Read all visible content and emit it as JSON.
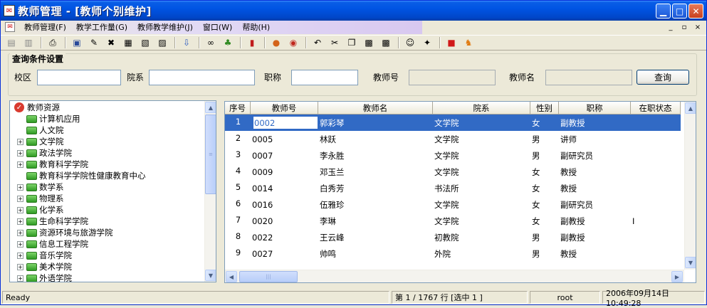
{
  "window": {
    "title": "教师管理 - [教师个别维护]",
    "title_icon": "app-icon",
    "accent": "#0054E3"
  },
  "menu": {
    "items": [
      "教师管理(F)",
      "教学工作量(G)",
      "教师教学维护(J)",
      "窗口(W)",
      "帮助(H)"
    ],
    "mdi": [
      "_",
      "▫",
      "×"
    ]
  },
  "toolbar": {
    "icons": [
      "new-icon",
      "delete-icon",
      "print-icon",
      "save-icon",
      "edit-icon",
      "cancel-icon",
      "disk-icon",
      "calc-icon",
      "trash-icon",
      "import-icon",
      "link-icon",
      "tree-icon",
      "chart-icon",
      "globe-icon",
      "color-icon",
      "undo-icon",
      "cut-icon",
      "copy-icon",
      "paste-icon",
      "paste2-icon",
      "user-icon",
      "tag-icon",
      "stop-icon",
      "run-icon"
    ]
  },
  "query": {
    "legend": "查询条件设置",
    "campus_label": "校区",
    "dept_label": "院系",
    "title_label": "职称",
    "teacher_no_label": "教师号",
    "teacher_name_label": "教师名",
    "search_button": "查询"
  },
  "tree": {
    "root": "教师资源",
    "items": [
      {
        "label": "计算机应用",
        "expandable": false
      },
      {
        "label": "人文院",
        "expandable": false
      },
      {
        "label": "文学院",
        "expandable": true
      },
      {
        "label": "政法学院",
        "expandable": true
      },
      {
        "label": "教育科学学院",
        "expandable": true
      },
      {
        "label": "教育科学学院性健康教育中心",
        "expandable": false
      },
      {
        "label": "数学系",
        "expandable": true
      },
      {
        "label": "物理系",
        "expandable": true
      },
      {
        "label": "化学系",
        "expandable": true
      },
      {
        "label": "生命科学学院",
        "expandable": true
      },
      {
        "label": "资源环境与旅游学院",
        "expandable": true
      },
      {
        "label": "信息工程学院",
        "expandable": true
      },
      {
        "label": "音乐学院",
        "expandable": true
      },
      {
        "label": "美术学院",
        "expandable": true
      },
      {
        "label": "外语学院",
        "expandable": true
      }
    ]
  },
  "grid": {
    "columns": [
      "序号",
      "教师号",
      "教师名",
      "院系",
      "性别",
      "职称",
      "在职状态"
    ],
    "rows": [
      [
        "1",
        "0002",
        "郭彩琴",
        "文学院",
        "女",
        "副教授",
        ""
      ],
      [
        "2",
        "0005",
        "林跃",
        "文学院",
        "男",
        "讲师",
        ""
      ],
      [
        "3",
        "0007",
        "李永胜",
        "文学院",
        "男",
        "副研究员",
        ""
      ],
      [
        "4",
        "0009",
        "邓玉兰",
        "文学院",
        "女",
        "教授",
        ""
      ],
      [
        "5",
        "0014",
        "白秀芳",
        "书法所",
        "女",
        "教授",
        ""
      ],
      [
        "6",
        "0016",
        "伍雅珍",
        "文学院",
        "女",
        "副研究员",
        ""
      ],
      [
        "7",
        "0020",
        "李琳",
        "文学院",
        "女",
        "副教授",
        "I"
      ],
      [
        "8",
        "0022",
        "王云峰",
        "初教院",
        "男",
        "副教授",
        ""
      ],
      [
        "9",
        "0027",
        "帅鸣",
        "外院",
        "男",
        "教授",
        ""
      ]
    ],
    "selected_row": 0
  },
  "status": {
    "ready": "Ready",
    "rows": "第 1 / 1767 行 [选中 1 ]",
    "user": "root",
    "datetime": "2006年09月14日 10:49:28"
  }
}
